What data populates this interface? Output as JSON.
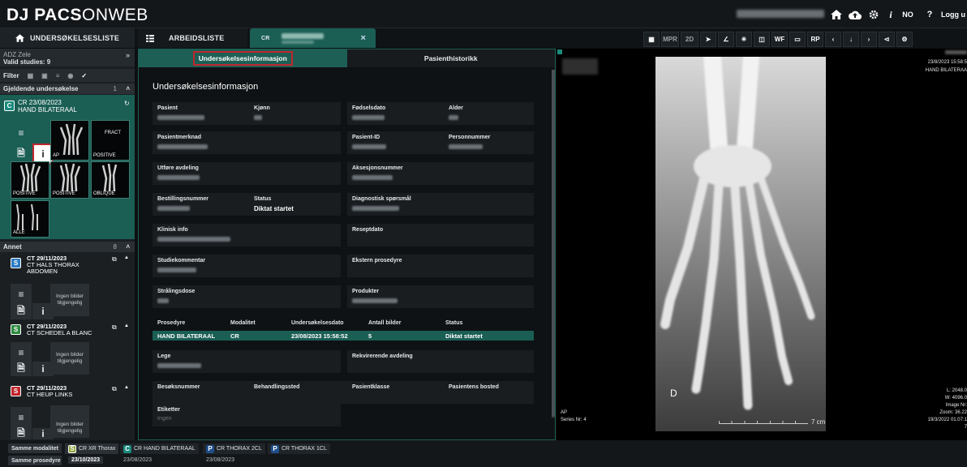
{
  "app": {
    "logo_bold": "PACS",
    "logo_light": "ONWEB",
    "logo_prefix": "DJ "
  },
  "topbar": {
    "language": "NO",
    "help": "?",
    "logout": "Logg u",
    "info": "i"
  },
  "tabs": {
    "worklist_study": "UNDERSØKELSESLISTE",
    "worklist": "ARBEIDSLISTE",
    "patient_modality": "CR",
    "close": "×"
  },
  "toolbar": {
    "mpr": "MPR",
    "twod": "2D",
    "wf": "WF",
    "rp": "RP"
  },
  "sidebar": {
    "zone": "ADZ Zele",
    "valid_studies": "Valid studies: 9",
    "filter": "Filter",
    "current_section": "Gjeldende undersøkelse",
    "current_count": "1",
    "current_study": {
      "letter": "C",
      "modality_date": "CR 23/08/2023",
      "description": "HAND BILATERAAL"
    },
    "thumb_labels": [
      "AP",
      "POSITIVE",
      "POSITIVE",
      "POSITIVE",
      "OBLIQUE",
      "ALLE"
    ],
    "thumb_text_fract": "FRACT",
    "other_section": "Annet",
    "other_count": "8",
    "other_studies": [
      {
        "letter": "S",
        "color": "#2b7bc4",
        "modality_date": "CT 29/11/2023",
        "description": "CT HALS THORAX",
        "description2": "ABDOMEN",
        "no_images": "Ingen bilder tilgjengelig"
      },
      {
        "letter": "S",
        "color": "#2e8a40",
        "modality_date": "CT 29/11/2023",
        "description": "CT SCHEDEL A BLANC",
        "description2": "",
        "no_images": "Ingen bilder tilgjengelig"
      },
      {
        "letter": "S",
        "color": "#c0262d",
        "modality_date": "CT 29/11/2023",
        "description": "CT HEUP LINKS",
        "description2": "",
        "no_images": "Ingen bilder tilgjengelig"
      }
    ]
  },
  "main": {
    "tab_info": "Undersøkelsesinformasjon",
    "tab_history": "Pasienthistorikk",
    "title": "Undersøkelsesinformasjon",
    "fields": {
      "pasient": "Pasient",
      "kjonn": "Kjønn",
      "fodselsdato": "Fødselsdato",
      "alder": "Alder",
      "pasientmerknad": "Pasientmerknad",
      "pasient_id": "Pasient-ID",
      "personnummer": "Personnummer",
      "utfore": "Utføre avdeling",
      "aksesjon": "Aksesjonsnummer",
      "bestilling": "Bestillingsnummer",
      "status": "Status",
      "status_value": "Diktat startet",
      "diagnostisk": "Diagnostisk spørsmål",
      "klinisk": "Klinisk info",
      "reseptdato": "Reseptdato",
      "studiekommentar": "Studiekommentar",
      "ekstern": "Ekstern prosedyre",
      "straling": "Strålingsdose",
      "produkter": "Produkter",
      "lege": "Lege",
      "rekvirerende": "Rekvirerende avdeling",
      "besok": "Besøksnummer",
      "behandling": "Behandlingssted",
      "pasientklasse": "Pasientklasse",
      "bosted": "Pasientens bosted",
      "etiketter": "Etiketter",
      "etiketter_value": "Ingen"
    },
    "procedure_headers": [
      "Prosedyre",
      "Modalitet",
      "Undersøkelsesdato",
      "Antall bilder",
      "Status"
    ],
    "procedure_row": [
      "HAND BILATERAAL",
      "CR",
      "23/08/2023 15:58:52",
      "5",
      "Diktat startet"
    ]
  },
  "viewer": {
    "top_right": [
      "23/8/2023 15:58:5",
      "HAND BILATERAA"
    ],
    "orientation": "D",
    "bottom_left": [
      "AP",
      "Series Nr: 4"
    ],
    "bottom_right": [
      "L: 2048.0",
      "W: 4096.0",
      "Image Nr:",
      "Zoom: 36.22",
      "19/3/2022 01:07:1",
      "7"
    ],
    "scale": "7 cm"
  },
  "bottom": {
    "same_modality": "Samme modalitet",
    "same_procedure": "Samme prosedyre",
    "studies": [
      {
        "letter": "S",
        "color": "#8fa13a",
        "name": "CR XR Thorax",
        "date": "23/10/2023"
      },
      {
        "letter": "C",
        "color": "#1a8a7c",
        "name": "CR HAND BILATERAAL",
        "date": "23/08/2023"
      },
      {
        "letter": "P",
        "color": "#1f4f8a",
        "name": "CR THORAX 2CL",
        "date": "23/08/2023"
      },
      {
        "letter": "P",
        "color": "#1f4f8a",
        "name": "CR THORAX 1CL",
        "date": ""
      }
    ]
  },
  "colors": {
    "accent": "#1a5e54",
    "highlight": "#c0262d"
  }
}
